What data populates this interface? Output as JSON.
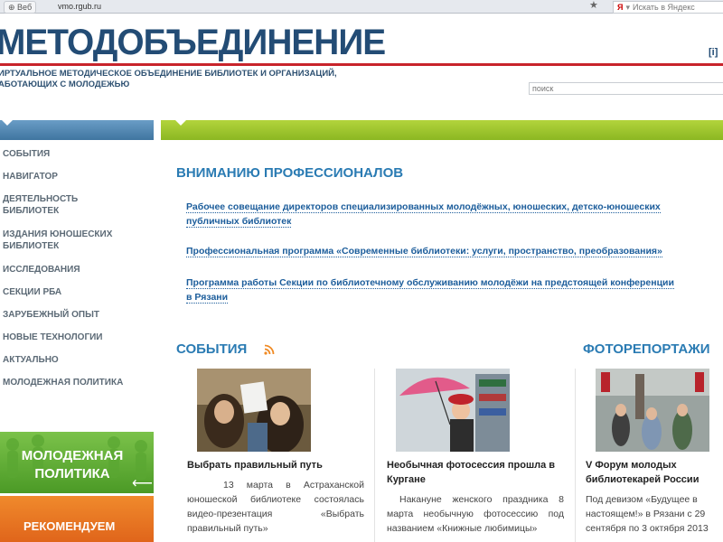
{
  "browser": {
    "tab_label": "Веб",
    "url": "vmo.rgub.ru",
    "search_placeholder": "Искать в Яндекс"
  },
  "header": {
    "logo": "МЕТОДОБЪЕДИНЕНИЕ",
    "tagline_line1": "ИРТУАЛЬНОЕ МЕТОДИЧЕСКОЕ ОБЪЕДИНЕНИЕ БИБЛИОТЕК И ОРГАНИЗАЦИЙ,",
    "tagline_line2": "АБОТАЮЩИХ С МОЛОДЕЖЬЮ",
    "info_label": "[i]",
    "search_placeholder": "поиск"
  },
  "sidebar": {
    "items": [
      {
        "label": "СОБЫТИЯ"
      },
      {
        "label": "НАВИГАТОР"
      },
      {
        "label": "ДЕЯТЕЛЬНОСТЬ БИБЛИОТЕК"
      },
      {
        "label": "ИЗДАНИЯ ЮНОШЕСКИХ БИБЛИОТЕК"
      },
      {
        "label": "ИССЛЕДОВАНИЯ"
      },
      {
        "label": "СЕКЦИИ РБА"
      },
      {
        "label": "ЗАРУБЕЖНЫЙ ОПЫТ"
      },
      {
        "label": "НОВЫЕ ТЕХНОЛОГИИ"
      },
      {
        "label": "АКТУАЛЬНО"
      },
      {
        "label": "МОЛОДЕЖНАЯ ПОЛИТИКА"
      }
    ],
    "banner_green": "МОЛОДЕЖНАЯ ПОЛИТИКА",
    "banner_orange": "РЕКОМЕНДУЕМ"
  },
  "main": {
    "section_title": "ВНИМАНИЮ ПРОФЕССИОНАЛОВ",
    "links": [
      {
        "line1": "Рабочее совещание директоров специализированных молодёжных, юношеских, детско-юношеских",
        "line2": "публичных библиотек"
      },
      {
        "line1": "Профессиональная программа «Современные библиотеки: услуги, пространство, преобразования»",
        "line2": ""
      },
      {
        "line1": "Программа работы Секции по библиотечному обслуживанию молодёжи на предстоящей конференции",
        "line2": "в Рязани"
      }
    ],
    "events_title": "СОБЫТИЯ",
    "photo_title": "ФОТОРЕПОРТАЖИ",
    "cards": [
      {
        "title": "Выбрать правильный путь",
        "text": "13 марта в Астраханской юношеской библиотеке состоялась видео-презентация «Выбрать правильный путь»"
      },
      {
        "title": "Необычная фотосессия прошла в Кургане",
        "text": "Накануне женского праздника 8 марта необычную фотосессию под названием «Книжные любимицы»"
      },
      {
        "title": "V Форум молодых библиотекарей России",
        "text": "Под девизом «Будущее в настоящем!» в Рязани с 29 сентября по 3 октября 2013"
      }
    ]
  },
  "colors": {
    "logo": "#234c75",
    "accent_red": "#c8242b",
    "link_blue": "#1c5d9b",
    "section_blue": "#2a7bb3",
    "bar_green": "#9cc42c",
    "bar_blue": "#4f86b1"
  }
}
